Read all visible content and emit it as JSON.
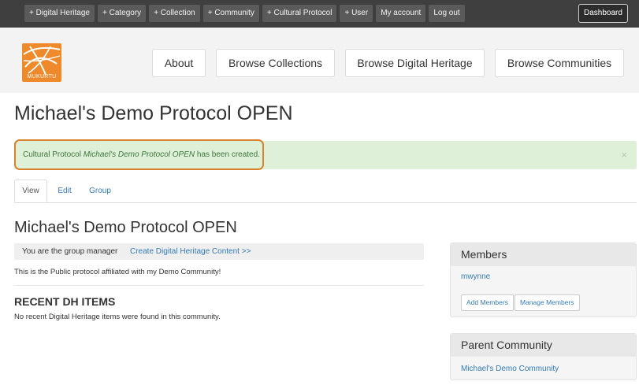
{
  "admin_bar": {
    "items": [
      {
        "label": "+ Digital Heritage"
      },
      {
        "label": "+ Category"
      },
      {
        "label": "+ Collection"
      },
      {
        "label": "+ Community"
      },
      {
        "label": "+ Cultural Protocol"
      },
      {
        "label": "+ User"
      },
      {
        "label": "My account"
      },
      {
        "label": "Log out"
      }
    ],
    "dashboard_label": "Dashboard"
  },
  "header": {
    "logo_text": "MUKURTU",
    "nav": [
      {
        "label": "About"
      },
      {
        "label": "Browse Collections"
      },
      {
        "label": "Browse Digital Heritage"
      },
      {
        "label": "Browse Communities"
      }
    ]
  },
  "page": {
    "title": "Michael's Demo Protocol OPEN",
    "status": {
      "prefix": "Cultural Protocol ",
      "name": "Michael's Demo Protocol OPEN",
      "suffix": " has been created.",
      "close": "×"
    },
    "tabs": [
      {
        "label": "View",
        "active": true
      },
      {
        "label": "Edit",
        "active": false
      },
      {
        "label": "Group",
        "active": false
      }
    ],
    "content_title": "Michael's Demo Protocol OPEN",
    "group_manager_text": "You are the group manager",
    "create_link": "Create Digital Heritage Content >>",
    "description": "This is the Public protocol affiliated with my Demo Community!",
    "recent_title": "RECENT DH ITEMS",
    "recent_empty": "No recent Digital Heritage items were found in this community."
  },
  "sidebar": {
    "members": {
      "title": "Members",
      "list": [
        "mwynne"
      ],
      "add_label": "Add Members",
      "manage_label": "Manage Members"
    },
    "parent": {
      "title": "Parent Community",
      "link": "Michael's Demo Community"
    }
  },
  "colors": {
    "admin_bar": "#3f3f3f",
    "brand_orange": "#ef8a2c",
    "link_blue": "#337ab7",
    "success_bg": "#dff0d8",
    "highlight": "#d9822b"
  }
}
